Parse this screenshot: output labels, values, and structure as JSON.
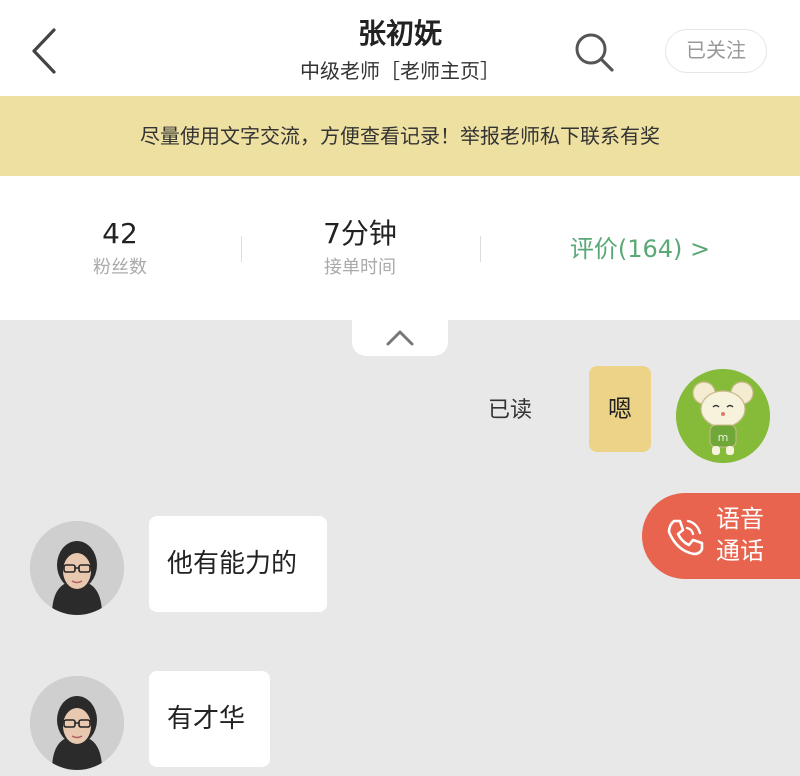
{
  "header": {
    "name": "张初妩",
    "subtitle": "中级老师［老师主页］",
    "follow_label": "已关注"
  },
  "notice": "尽量使用文字交流，方便查看记录！举报老师私下联系有奖",
  "stats": {
    "fans": {
      "value": "42",
      "label": "粉丝数"
    },
    "response": {
      "value": "7分钟",
      "label": "接单时间"
    },
    "review_label": "评价(164) >"
  },
  "chat": {
    "self_message": "嗯",
    "read_status": "已读",
    "messages": [
      {
        "text": "他有能力的"
      },
      {
        "text": "有才华"
      }
    ]
  },
  "voice_call": {
    "label": "语音通话"
  },
  "colors": {
    "notice_bg": "#ede0a1",
    "self_bubble": "#edd387",
    "review_green": "#5aa876",
    "voice_btn": "#e8644e",
    "chat_bg": "#e8e8e8"
  },
  "icons": [
    "back-arrow-icon",
    "search-icon",
    "chevron-up-icon",
    "phone-icon",
    "mouse-avatar",
    "teacher-avatar"
  ]
}
